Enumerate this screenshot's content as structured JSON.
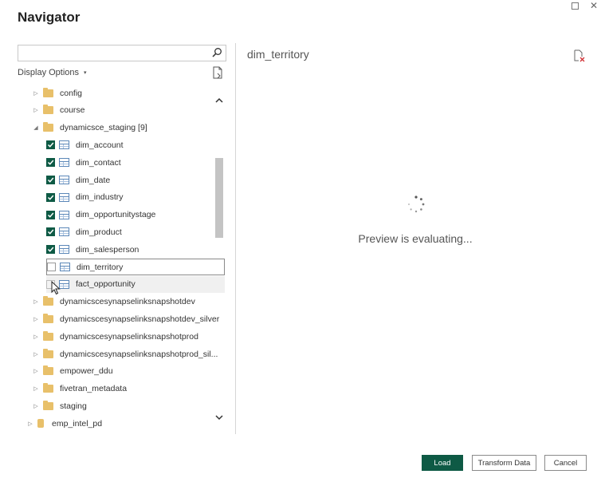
{
  "window": {
    "maximize_icon": "maximize-icon",
    "close_icon": "close-icon"
  },
  "dialog": {
    "title": "Navigator"
  },
  "search": {
    "value": "",
    "placeholder": "",
    "icon": "search-icon"
  },
  "display_options": {
    "label": "Display Options",
    "caret": "▾"
  },
  "tree": {
    "items": [
      {
        "label": "config",
        "kind": "folder",
        "expanded": false
      },
      {
        "label": "course",
        "kind": "folder",
        "expanded": false
      },
      {
        "label": "dynamicsce_staging [9]",
        "kind": "folder",
        "expanded": true
      },
      {
        "label": "dim_account",
        "kind": "table",
        "checked": true
      },
      {
        "label": "dim_contact",
        "kind": "table",
        "checked": true
      },
      {
        "label": "dim_date",
        "kind": "table",
        "checked": true
      },
      {
        "label": "dim_industry",
        "kind": "table",
        "checked": true
      },
      {
        "label": "dim_opportunitystage",
        "kind": "table",
        "checked": true
      },
      {
        "label": "dim_product",
        "kind": "table",
        "checked": true
      },
      {
        "label": "dim_salesperson",
        "kind": "table",
        "checked": true
      },
      {
        "label": "dim_territory",
        "kind": "table",
        "checked": false,
        "selected": true
      },
      {
        "label": "fact_opportunity",
        "kind": "table",
        "checked": false,
        "hover": true
      },
      {
        "label": "dynamicscesynapselinksnapshotdev",
        "kind": "folder",
        "expanded": false
      },
      {
        "label": "dynamicscesynapselinksnapshotdev_silver",
        "kind": "folder",
        "expanded": false
      },
      {
        "label": "dynamicscesynapselinksnapshotprod",
        "kind": "folder",
        "expanded": false
      },
      {
        "label": "dynamicscesynapselinksnapshotprod_sil...",
        "kind": "folder",
        "expanded": false
      },
      {
        "label": "empower_ddu",
        "kind": "folder",
        "expanded": false
      },
      {
        "label": "fivetran_metadata",
        "kind": "folder",
        "expanded": false
      },
      {
        "label": "staging",
        "kind": "folder",
        "expanded": false
      },
      {
        "label": "emp_intel_pd",
        "kind": "database",
        "expanded": false
      }
    ]
  },
  "preview": {
    "title": "dim_territory",
    "status": "Preview is evaluating..."
  },
  "footer": {
    "load": "Load",
    "transform": "Transform Data",
    "cancel": "Cancel"
  },
  "colors": {
    "accent": "#0e5a45",
    "folder": "#e8c06a",
    "table_icon": "#5b87b8"
  }
}
